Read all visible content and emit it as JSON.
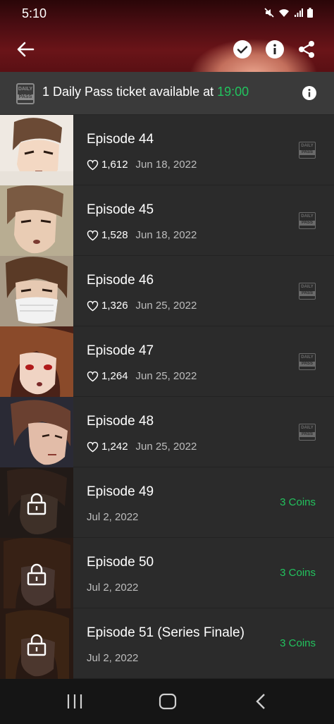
{
  "status": {
    "time": "5:10"
  },
  "banner": {
    "icon_line1": "DAILY",
    "icon_line2": "PASS",
    "text_prefix": "1 Daily Pass ticket available at ",
    "time": "19:00",
    "time_color": "#22c35e"
  },
  "episodes": [
    {
      "title": "Episode 44",
      "likes": "1,612",
      "date": "Jun 18, 2022",
      "access": "daily-pass",
      "dp1": "DAILY",
      "dp2": "PASS"
    },
    {
      "title": "Episode 45",
      "likes": "1,528",
      "date": "Jun 18, 2022",
      "access": "daily-pass",
      "dp1": "DAILY",
      "dp2": "PASS"
    },
    {
      "title": "Episode 46",
      "likes": "1,326",
      "date": "Jun 25, 2022",
      "access": "daily-pass",
      "dp1": "DAILY",
      "dp2": "PASS"
    },
    {
      "title": "Episode 47",
      "likes": "1,264",
      "date": "Jun 25, 2022",
      "access": "daily-pass",
      "dp1": "DAILY",
      "dp2": "PASS"
    },
    {
      "title": "Episode 48",
      "likes": "1,242",
      "date": "Jun 25, 2022",
      "access": "daily-pass",
      "dp1": "DAILY",
      "dp2": "PASS"
    },
    {
      "title": "Episode 49",
      "date": "Jul 2, 2022",
      "access": "locked",
      "price": "3 Coins"
    },
    {
      "title": "Episode 50",
      "date": "Jul 2, 2022",
      "access": "locked",
      "price": "3 Coins"
    },
    {
      "title": "Episode 51 (Series Finale)",
      "date": "Jul 2, 2022",
      "access": "locked",
      "price": "3 Coins"
    }
  ],
  "colors": {
    "accent_green": "#22c35e",
    "row_bg": "#2b2b2b",
    "banner_bg": "#3a3a3a"
  }
}
